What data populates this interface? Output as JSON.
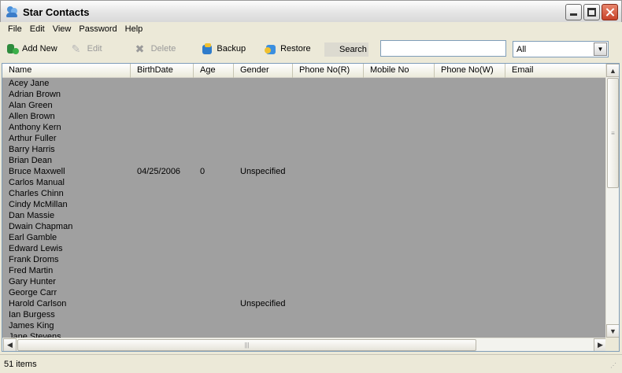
{
  "window": {
    "title": "Star Contacts"
  },
  "menu": [
    "File",
    "Edit",
    "View",
    "Password",
    "Help"
  ],
  "toolbar": {
    "add_new": "Add New",
    "edit": "Edit",
    "delete": "Delete",
    "backup": "Backup",
    "restore": "Restore",
    "search_label": "Search",
    "search_value": "",
    "filter_value": "All"
  },
  "columns": [
    "Name",
    "BirthDate",
    "Age",
    "Gender",
    "Phone No(R)",
    "Mobile No",
    "Phone No(W)",
    "Email"
  ],
  "rows": [
    [
      "Acey Jane",
      "",
      "",
      "",
      "",
      "",
      "",
      ""
    ],
    [
      "Adrian Brown",
      "",
      "",
      "",
      "",
      "",
      "",
      ""
    ],
    [
      "Alan Green",
      "",
      "",
      "",
      "",
      "",
      "",
      ""
    ],
    [
      "Allen Brown",
      "",
      "",
      "",
      "",
      "",
      "",
      ""
    ],
    [
      "Anthony Kern",
      "",
      "",
      "",
      "",
      "",
      "",
      ""
    ],
    [
      "Arthur Fuller",
      "",
      "",
      "",
      "",
      "",
      "",
      ""
    ],
    [
      "Barry Harris",
      "",
      "",
      "",
      "",
      "",
      "",
      ""
    ],
    [
      "Brian Dean",
      "",
      "",
      "",
      "",
      "",
      "",
      ""
    ],
    [
      "Bruce Maxwell",
      "04/25/2006",
      "0",
      "Unspecified",
      "",
      "",
      "",
      ""
    ],
    [
      "Carlos Manual",
      "",
      "",
      "",
      "",
      "",
      "",
      ""
    ],
    [
      "Charles Chinn",
      "",
      "",
      "",
      "",
      "",
      "",
      ""
    ],
    [
      "Cindy McMillan",
      "",
      "",
      "",
      "",
      "",
      "",
      ""
    ],
    [
      "Dan Massie",
      "",
      "",
      "",
      "",
      "",
      "",
      ""
    ],
    [
      "Dwain Chapman",
      "",
      "",
      "",
      "",
      "",
      "",
      ""
    ],
    [
      "Earl Gamble",
      "",
      "",
      "",
      "",
      "",
      "",
      ""
    ],
    [
      "Edward Lewis",
      "",
      "",
      "",
      "",
      "",
      "",
      ""
    ],
    [
      "Frank Droms",
      "",
      "",
      "",
      "",
      "",
      "",
      ""
    ],
    [
      "Fred Martin",
      "",
      "",
      "",
      "",
      "",
      "",
      ""
    ],
    [
      "Gary Hunter",
      "",
      "",
      "",
      "",
      "",
      "",
      ""
    ],
    [
      "George Carr",
      "",
      "",
      "",
      "",
      "",
      "",
      ""
    ],
    [
      "Harold Carlson",
      "",
      "",
      "Unspecified",
      "",
      "",
      "",
      ""
    ],
    [
      "Ian Burgess",
      "",
      "",
      "",
      "",
      "",
      "",
      ""
    ],
    [
      "James King",
      "",
      "",
      "",
      "",
      "",
      "",
      ""
    ],
    [
      "Jane Stevens",
      "",
      "",
      "",
      "",
      "",
      "",
      ""
    ]
  ],
  "status": {
    "count_text": "51 items"
  },
  "colors": {
    "list_background": "#a0a0a0",
    "window_face": "#ece9d8",
    "input_border": "#7f9db9"
  }
}
